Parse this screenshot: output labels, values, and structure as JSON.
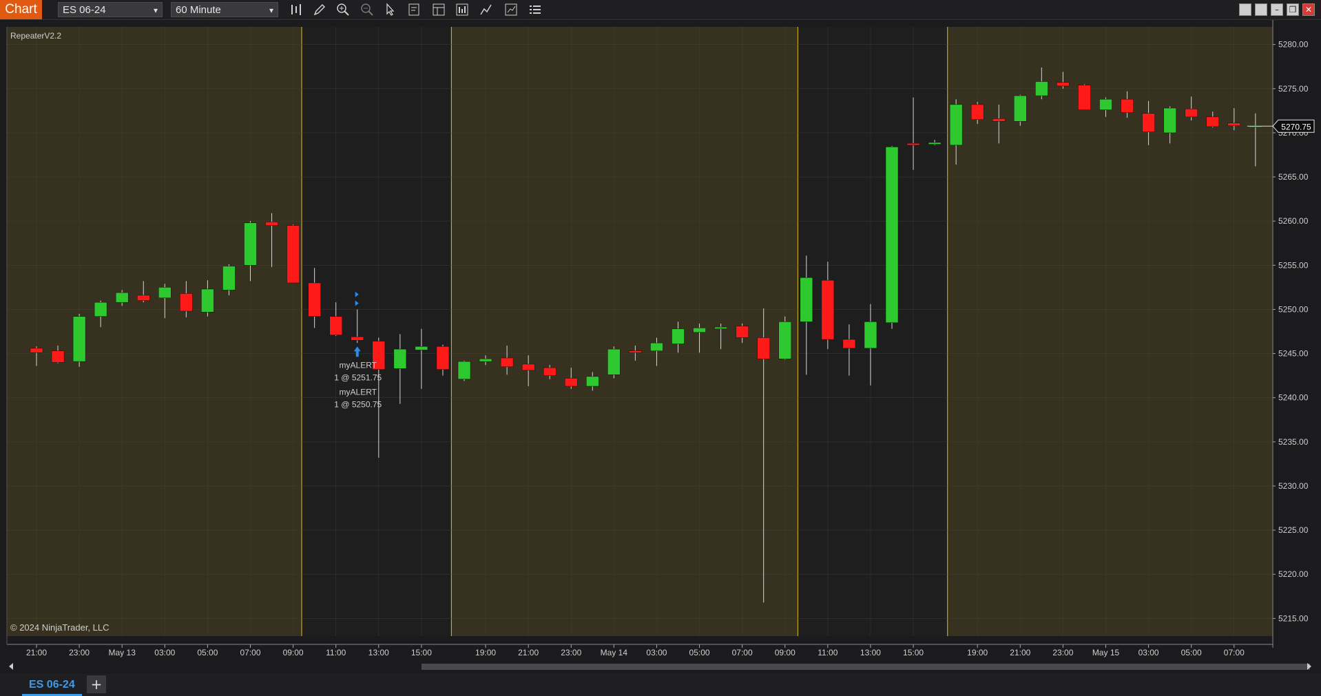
{
  "toolbar": {
    "chart_label": "Chart",
    "instrument": "ES 06-24",
    "timeframe": "60 Minute",
    "tools": [
      "bar-type-icon",
      "pencil-icon",
      "zoom-in-icon",
      "zoom-out-icon",
      "pointer-icon",
      "data-box-icon",
      "properties-icon",
      "strategies-icon",
      "indicators-icon",
      "chart-trader-icon",
      "menu-icon"
    ]
  },
  "indicator_label": "RepeaterV2.2",
  "copyright": "© 2024 NinjaTrader, LLC",
  "current_price": "5270.75",
  "tab": {
    "label": "ES 06-24",
    "add_label": "+"
  },
  "colors": {
    "up": "#2ec92e",
    "down": "#ff1a1a",
    "session": "#37311f",
    "night": "#1e1e1f",
    "session_line": "#e0c020",
    "alert_arrow": "#2a8cf0"
  },
  "annotations": [
    {
      "name": "myALERT",
      "detail": "1 @ 5251.75"
    },
    {
      "name": "myALERT",
      "detail": "1 @ 5250.75"
    }
  ],
  "chart_data": {
    "type": "candlestick",
    "ylim": [
      5213,
      5282
    ],
    "y_ticks": [
      "5280.00",
      "5275.00",
      "5270.00",
      "5265.00",
      "5260.00",
      "5255.00",
      "5250.00",
      "5245.00",
      "5240.00",
      "5235.00",
      "5230.00",
      "5225.00",
      "5220.00",
      "5215.00"
    ],
    "x_ticks": [
      "21:00",
      "23:00",
      "May 13",
      "03:00",
      "05:00",
      "07:00",
      "09:00",
      "11:00",
      "13:00",
      "15:00",
      "19:00",
      "21:00",
      "23:00",
      "May 14",
      "03:00",
      "05:00",
      "07:00",
      "09:00",
      "11:00",
      "13:00",
      "15:00",
      "19:00",
      "21:00",
      "23:00",
      "May 15",
      "03:00",
      "05:00",
      "07:00"
    ],
    "candles": [
      [
        5245.6,
        5245.8,
        5243.6,
        5245.1
      ],
      [
        5245.3,
        5245.9,
        5243.9,
        5244.0
      ],
      [
        5244.1,
        5249.5,
        5243.5,
        5249.2
      ],
      [
        5249.2,
        5251.0,
        5248.0,
        5250.8
      ],
      [
        5250.8,
        5252.2,
        5250.4,
        5251.9
      ],
      [
        5251.6,
        5253.2,
        5250.8,
        5251.0
      ],
      [
        5251.3,
        5252.9,
        5249.0,
        5252.5
      ],
      [
        5251.8,
        5253.2,
        5249.1,
        5249.8
      ],
      [
        5249.7,
        5253.3,
        5249.2,
        5252.3
      ],
      [
        5252.2,
        5255.1,
        5251.6,
        5254.9
      ],
      [
        5255.0,
        5260.0,
        5253.2,
        5259.8
      ],
      [
        5259.9,
        5260.9,
        5254.8,
        5259.5
      ],
      [
        5259.5,
        5259.6,
        5253.0,
        5253.0
      ],
      [
        5253.0,
        5254.7,
        5247.9,
        5249.2
      ],
      [
        5249.2,
        5250.8,
        5247.0,
        5247.1
      ],
      [
        5246.9,
        5250.0,
        5246.2,
        5246.5
      ],
      [
        5246.4,
        5246.8,
        5233.2,
        5243.2
      ],
      [
        5243.3,
        5247.2,
        5239.3,
        5245.5
      ],
      [
        5245.4,
        5247.8,
        5241.0,
        5245.8
      ],
      [
        5245.8,
        5246.0,
        5242.5,
        5243.2
      ],
      [
        5242.1,
        5244.2,
        5241.9,
        5244.1
      ],
      [
        5244.1,
        5244.8,
        5243.7,
        5244.4
      ],
      [
        5244.5,
        5245.9,
        5242.6,
        5243.5
      ],
      [
        5243.8,
        5244.8,
        5241.3,
        5243.1
      ],
      [
        5243.4,
        5243.7,
        5242.1,
        5242.5
      ],
      [
        5242.2,
        5243.4,
        5241.0,
        5241.3
      ],
      [
        5241.3,
        5242.9,
        5240.8,
        5242.4
      ],
      [
        5242.6,
        5245.8,
        5242.2,
        5245.5
      ],
      [
        5245.3,
        5245.9,
        5244.2,
        5245.1
      ],
      [
        5245.3,
        5246.8,
        5243.6,
        5246.2
      ],
      [
        5246.1,
        5248.6,
        5245.1,
        5247.8
      ],
      [
        5247.4,
        5248.4,
        5245.1,
        5247.9
      ],
      [
        5247.8,
        5248.4,
        5245.5,
        5248.0
      ],
      [
        5248.1,
        5248.4,
        5246.2,
        5246.8
      ],
      [
        5246.8,
        5250.1,
        5216.8,
        5244.4
      ],
      [
        5244.4,
        5249.2,
        5244.3,
        5248.6
      ],
      [
        5248.6,
        5256.1,
        5242.6,
        5253.6
      ],
      [
        5253.3,
        5255.4,
        5245.5,
        5246.6
      ],
      [
        5246.6,
        5248.3,
        5242.5,
        5245.6
      ],
      [
        5245.6,
        5250.6,
        5241.4,
        5248.6
      ],
      [
        5248.5,
        5268.5,
        5247.8,
        5268.4
      ],
      [
        5268.8,
        5274.0,
        5265.8,
        5268.6
      ],
      [
        5268.7,
        5269.2,
        5268.6,
        5268.9
      ],
      [
        5268.6,
        5273.8,
        5266.4,
        5273.2
      ],
      [
        5273.2,
        5273.5,
        5271.0,
        5271.5
      ],
      [
        5271.6,
        5273.2,
        5268.8,
        5271.3
      ],
      [
        5271.3,
        5274.3,
        5270.8,
        5274.2
      ],
      [
        5274.2,
        5277.4,
        5273.8,
        5275.8
      ],
      [
        5275.7,
        5276.9,
        5275.0,
        5275.3
      ],
      [
        5275.4,
        5275.5,
        5272.6,
        5272.6
      ],
      [
        5272.6,
        5274.0,
        5271.8,
        5273.8
      ],
      [
        5273.8,
        5274.7,
        5271.7,
        5272.3
      ],
      [
        5272.2,
        5273.6,
        5268.6,
        5270.1
      ],
      [
        5270.0,
        5273.0,
        5268.8,
        5272.8
      ],
      [
        5272.7,
        5274.1,
        5271.4,
        5271.8
      ],
      [
        5271.8,
        5272.4,
        5270.6,
        5270.7
      ],
      [
        5271.1,
        5272.8,
        5270.3,
        5270.8
      ],
      [
        5270.8,
        5272.2,
        5266.2,
        5270.8
      ]
    ],
    "sessions": [
      {
        "from": 0,
        "to": 12.4,
        "type": "rth"
      },
      {
        "from": 12.4,
        "to": 19.4,
        "type": "eth"
      },
      {
        "from": 19.4,
        "to": 35.6,
        "type": "rth"
      },
      {
        "from": 35.6,
        "to": 42.6,
        "type": "eth"
      },
      {
        "from": 42.6,
        "to": 58,
        "type": "rth"
      }
    ]
  }
}
